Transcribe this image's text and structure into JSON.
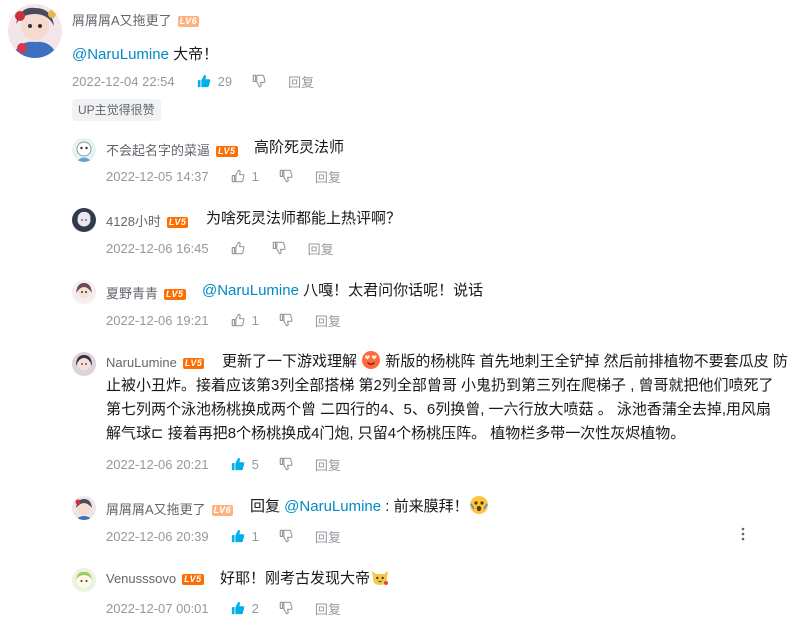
{
  "root": {
    "username": "屑屑屑A又拖更了",
    "level": "LV6",
    "mention": "@NaruLumine",
    "text": " 大帝！",
    "time": "2022-12-04 22:54",
    "likes": "29",
    "reply_label": "回复",
    "up_tag": "UP主觉得很赞"
  },
  "replies": [
    {
      "username": "不会起名字的菜逼",
      "level": "LV5",
      "text": "高阶死灵法师",
      "time": "2022-12-05 14:37",
      "likes": "1",
      "reply_label": "回复"
    },
    {
      "username": "4128小时",
      "level": "LV5",
      "text": "为啥死灵法师都能上热评啊？",
      "time": "2022-12-06 16:45",
      "likes": "",
      "reply_label": "回复"
    },
    {
      "username": "夏野青青",
      "level": "LV5",
      "mention": "@NaruLumine",
      "text": " 八嘎！太君问你话呢！说话",
      "time": "2022-12-06 19:21",
      "likes": "1",
      "reply_label": "回复"
    },
    {
      "username": "NaruLumine",
      "level": "LV5",
      "text_before_emoji": "更新了一下游戏理解 ",
      "text_after_emoji": " 新版的杨桃阵 首先地刺王全铲掉 然后前排植物不要套瓜皮 防",
      "text_lines": [
        "止被小丑炸。接着应该第3列全部搭梯  第2列全部曾哥  小鬼扔到第三列在爬梯子 , 曾哥就把他们喷死了",
        "第七列两个泳池杨桃换成两个曾    二四行的4、5、6列换曾, 一六行放大喷菇 。 泳池香蒲全去掉,用风扇",
        "解气球⊏   接着再把8个杨桃换成4门炮, 只留4个杨桃压阵。   植物栏多带一次性灰烬植物。"
      ],
      "time": "2022-12-06 20:21",
      "likes": "5",
      "reply_label": "回复"
    },
    {
      "username": "屑屑屑A又拖更了",
      "level": "LV6",
      "prefix": "回复 ",
      "mention": "@NaruLumine",
      "text": " : 前来膜拜！",
      "time": "2022-12-06 20:39",
      "likes": "1",
      "reply_label": "回复"
    },
    {
      "username": "Venusssovo",
      "level": "LV5",
      "text": "好耶！刚考古发现大帝",
      "time": "2022-12-07 00:01",
      "likes": "2",
      "reply_label": "回复"
    }
  ],
  "colors": {
    "mention": "#008ac5",
    "liked": "#00aeec",
    "meta": "#9499a0",
    "lv5": "#ff6c00",
    "lv6": "#ffb27f"
  },
  "icons": {
    "like": "thumb-up-icon",
    "dislike": "thumb-down-icon",
    "more": "more-vertical-icon"
  }
}
